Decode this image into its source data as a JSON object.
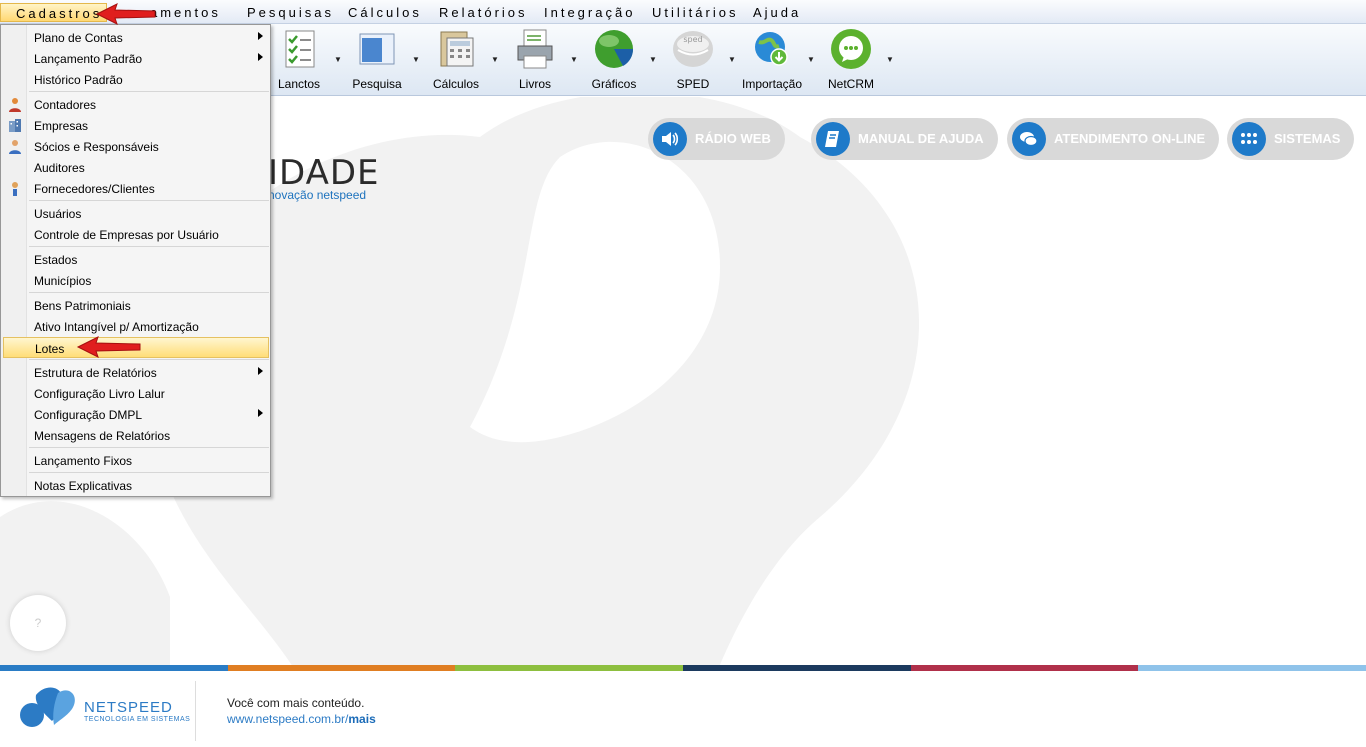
{
  "menubar": {
    "items": [
      "Cadastros",
      "Lançamentos",
      "Pesquisas",
      "Cálculos",
      "Relatórios",
      "Integração",
      "Utilitários",
      "Ajuda"
    ],
    "hidden_fragment": "ç",
    "visible_partial": "amentos"
  },
  "toolbar": {
    "buttons": [
      {
        "label": "Lanctos",
        "icon": "checklist-icon"
      },
      {
        "label": "Pesquisa",
        "icon": "window-icon"
      },
      {
        "label": "Cálculos",
        "icon": "calculator-icon"
      },
      {
        "label": "Livros",
        "icon": "printer-icon"
      },
      {
        "label": "Gráficos",
        "icon": "pie-chart-icon"
      },
      {
        "label": "SPED",
        "icon": "sped-icon"
      },
      {
        "label": "Importação",
        "icon": "globe-download-icon"
      },
      {
        "label": "NetCRM",
        "icon": "chat-bubble-icon"
      }
    ]
  },
  "dropdown": {
    "items": [
      {
        "label": "Plano de Contas",
        "submenu": true
      },
      {
        "label": "Lançamento Padrão",
        "submenu": true
      },
      {
        "label": "Histórico Padrão"
      },
      {
        "label": "Contadores",
        "icon": "person-icon"
      },
      {
        "label": "Empresas",
        "icon": "buildings-icon"
      },
      {
        "label": "Sócios e Responsáveis",
        "icon": "partners-icon"
      },
      {
        "label": "Auditores"
      },
      {
        "label": "Fornecedores/Clientes",
        "icon": "supplier-icon"
      },
      {
        "label": "Usuários"
      },
      {
        "label": "Controle de Empresas por Usuário"
      },
      {
        "label": "Estados"
      },
      {
        "label": "Municípios"
      },
      {
        "label": "Bens Patrimoniais"
      },
      {
        "label": "Ativo Intangível p/ Amortização"
      },
      {
        "label": "Lotes",
        "highlighted": true
      },
      {
        "label": "Estrutura de Relatórios",
        "submenu": true
      },
      {
        "label": "Configuração Livro Lalur"
      },
      {
        "label": "Configuração DMPL",
        "submenu": true
      },
      {
        "label": "Mensagens de Relatórios"
      },
      {
        "label": "Lançamento Fixos"
      },
      {
        "label": "Notas Explicativas"
      }
    ]
  },
  "quick_links": [
    {
      "label": "RÁDIO WEB",
      "icon": "speaker-icon"
    },
    {
      "label": "MANUAL DE AJUDA",
      "icon": "book-icon"
    },
    {
      "label": "ATENDIMENTO ON-LINE",
      "icon": "chat-icon"
    },
    {
      "label": "SISTEMAS",
      "icon": "grid-dots-icon"
    }
  ],
  "main": {
    "logo_partial": "IDADE",
    "logo_tagline_partial": "novação netspeed",
    "help_label": "?"
  },
  "footer": {
    "brand": "NETSPEED",
    "brand_sub": "TECNOLOGIA EM SISTEMAS",
    "line1": "Você com mais conteúdo.",
    "url_prefix": "www.netspeed.com.br/",
    "url_bold": "mais"
  },
  "colors": {
    "strip": [
      "#2a7cc5",
      "#e07e22",
      "#8dbf3f",
      "#1c3a5e",
      "#b0304a",
      "#8fc3ea"
    ],
    "accent": "#1e7ac9"
  }
}
